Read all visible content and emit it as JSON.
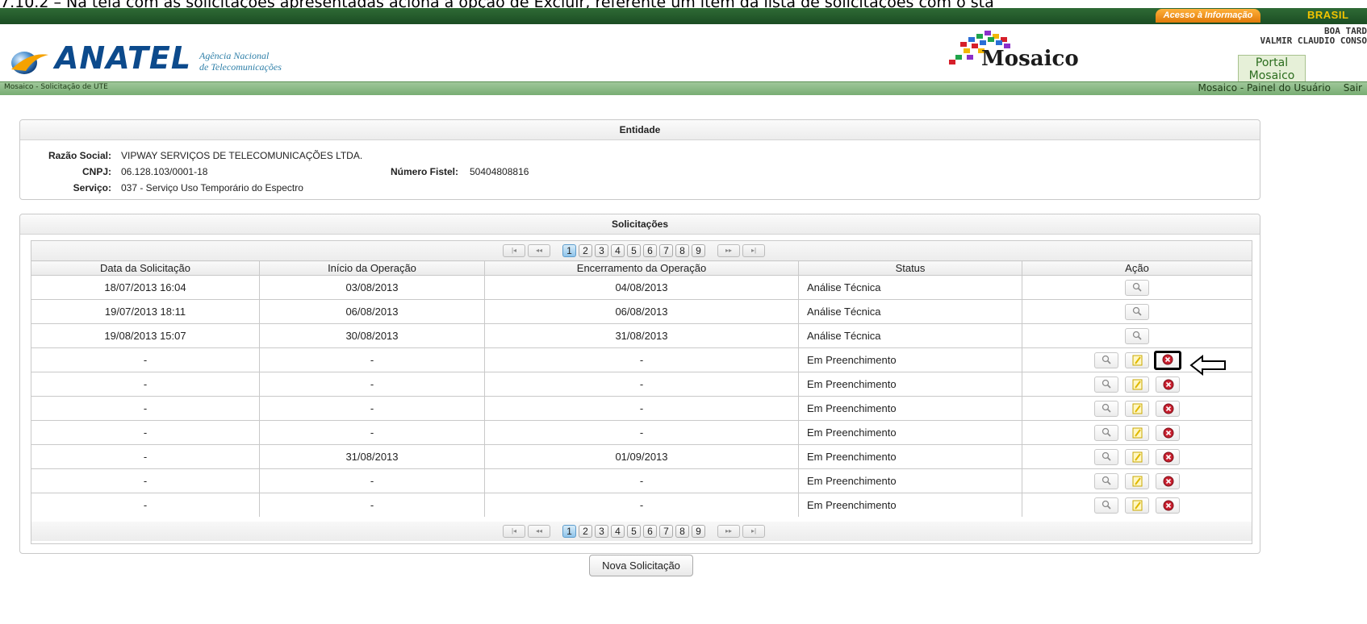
{
  "doc_caption": "7.10.2 – Na tela com as solicitações apresentadas aciona a opção de Excluir, referente um item da lista de solicitações com o sta",
  "gov_bar": {
    "acesso": "Acesso à Informação",
    "brasil": "BRASIL"
  },
  "header": {
    "anatel_name": "ANATEL",
    "anatel_sub_line1": "Agência Nacional",
    "anatel_sub_line2": "de Telecomunicações",
    "system_name": "Mosaico",
    "greeting_line1": "BOA TARD",
    "greeting_line2": "VALMIR CLAUDIO CONSO",
    "portal_tab_line1": "Portal",
    "portal_tab_line2": "Mosaico"
  },
  "nav": {
    "breadcrumb": "Mosaico - Solicitação de UTE",
    "painel": "Mosaico - Painel do Usuário",
    "sair": "Sair"
  },
  "entidade": {
    "title": "Entidade",
    "razao_label": "Razão Social:",
    "razao_value": "VIPWAY SERVIÇOS DE TELECOMUNICAÇÕES LTDA.",
    "cnpj_label": "CNPJ:",
    "cnpj_value": "06.128.103/0001-18",
    "fistel_label": "Número Fistel:",
    "fistel_value": "50404808816",
    "servico_label": "Serviço:",
    "servico_value": "037 - Serviço Uso Temporário do Espectro"
  },
  "solicitacoes": {
    "title": "Solicitações",
    "pages": [
      "1",
      "2",
      "3",
      "4",
      "5",
      "6",
      "7",
      "8",
      "9"
    ],
    "current_page": "1",
    "columns": [
      "Data da Solicitação",
      "Início da Operação",
      "Encerramento da Operação",
      "Status",
      "Ação"
    ],
    "rows": [
      {
        "data": "18/07/2013 16:04",
        "inicio": "03/08/2013",
        "fim": "04/08/2013",
        "status": "Análise Técnica",
        "actions": [
          "view"
        ]
      },
      {
        "data": "19/07/2013 18:11",
        "inicio": "06/08/2013",
        "fim": "06/08/2013",
        "status": "Análise Técnica",
        "actions": [
          "view"
        ]
      },
      {
        "data": "19/08/2013 15:07",
        "inicio": "30/08/2013",
        "fim": "31/08/2013",
        "status": "Análise Técnica",
        "actions": [
          "view"
        ]
      },
      {
        "data": "-",
        "inicio": "-",
        "fim": "-",
        "status": "Em Preenchimento",
        "actions": [
          "view",
          "edit",
          "delete"
        ],
        "highlight_delete": true
      },
      {
        "data": "-",
        "inicio": "-",
        "fim": "-",
        "status": "Em Preenchimento",
        "actions": [
          "view",
          "edit",
          "delete"
        ]
      },
      {
        "data": "-",
        "inicio": "-",
        "fim": "-",
        "status": "Em Preenchimento",
        "actions": [
          "view",
          "edit",
          "delete"
        ]
      },
      {
        "data": "-",
        "inicio": "-",
        "fim": "-",
        "status": "Em Preenchimento",
        "actions": [
          "view",
          "edit",
          "delete"
        ]
      },
      {
        "data": "-",
        "inicio": "31/08/2013",
        "fim": "01/09/2013",
        "status": "Em Preenchimento",
        "actions": [
          "view",
          "edit",
          "delete"
        ]
      },
      {
        "data": "-",
        "inicio": "-",
        "fim": "-",
        "status": "Em Preenchimento",
        "actions": [
          "view",
          "edit",
          "delete"
        ]
      },
      {
        "data": "-",
        "inicio": "-",
        "fim": "-",
        "status": "Em Preenchimento",
        "actions": [
          "view",
          "edit",
          "delete"
        ]
      }
    ]
  },
  "nova_button": "Nova Solicitação"
}
